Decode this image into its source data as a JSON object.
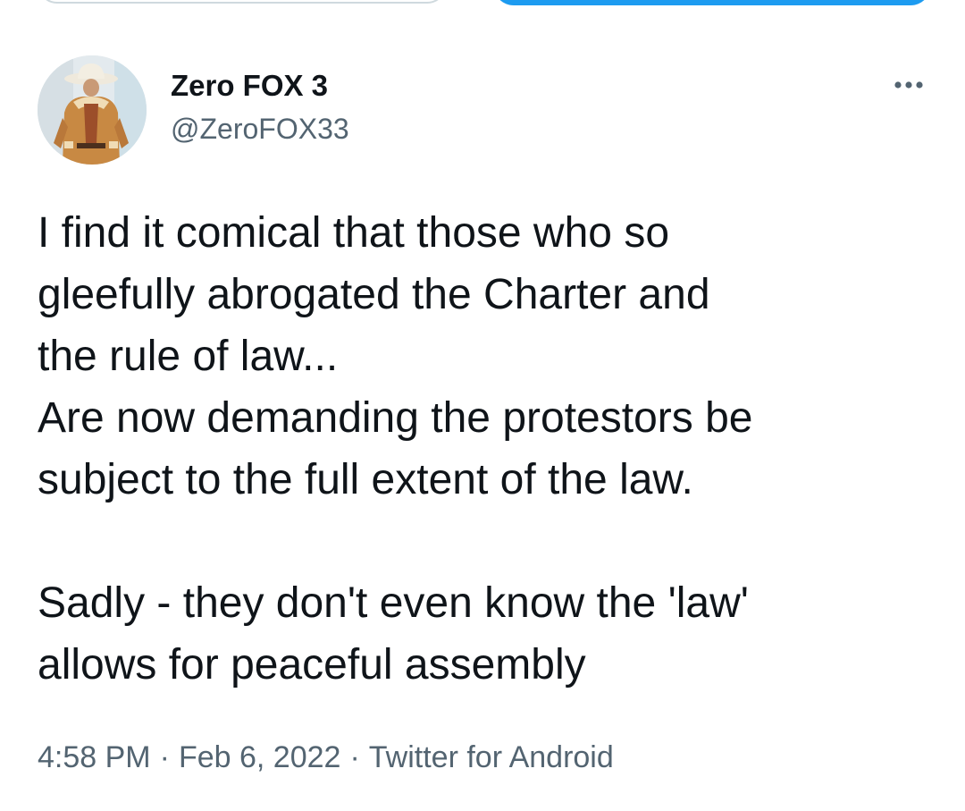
{
  "header": {
    "buttons": [
      "",
      ""
    ]
  },
  "author": {
    "display_name": "Zero FOX 3",
    "handle": "@ZeroFOX33",
    "avatar_icon": "avatar-cowboy-photo"
  },
  "more_icon": "more-horizontal-icon",
  "tweet": {
    "lines": [
      "I find it comical that those who so",
      "gleefully abrogated the Charter and",
      "the rule of law...",
      "Are now demanding the protestors be",
      "subject to the full extent of the law.",
      "",
      "Sadly - they don't even know the 'law'",
      "allows for peaceful assembly"
    ]
  },
  "meta": {
    "time": "4:58 PM",
    "separator": "·",
    "date": "Feb 6, 2022",
    "source": "Twitter for Android"
  },
  "colors": {
    "accent": "#1d9bf0",
    "text": "#0f1419",
    "secondary": "#536471",
    "border": "#cfd9de"
  }
}
